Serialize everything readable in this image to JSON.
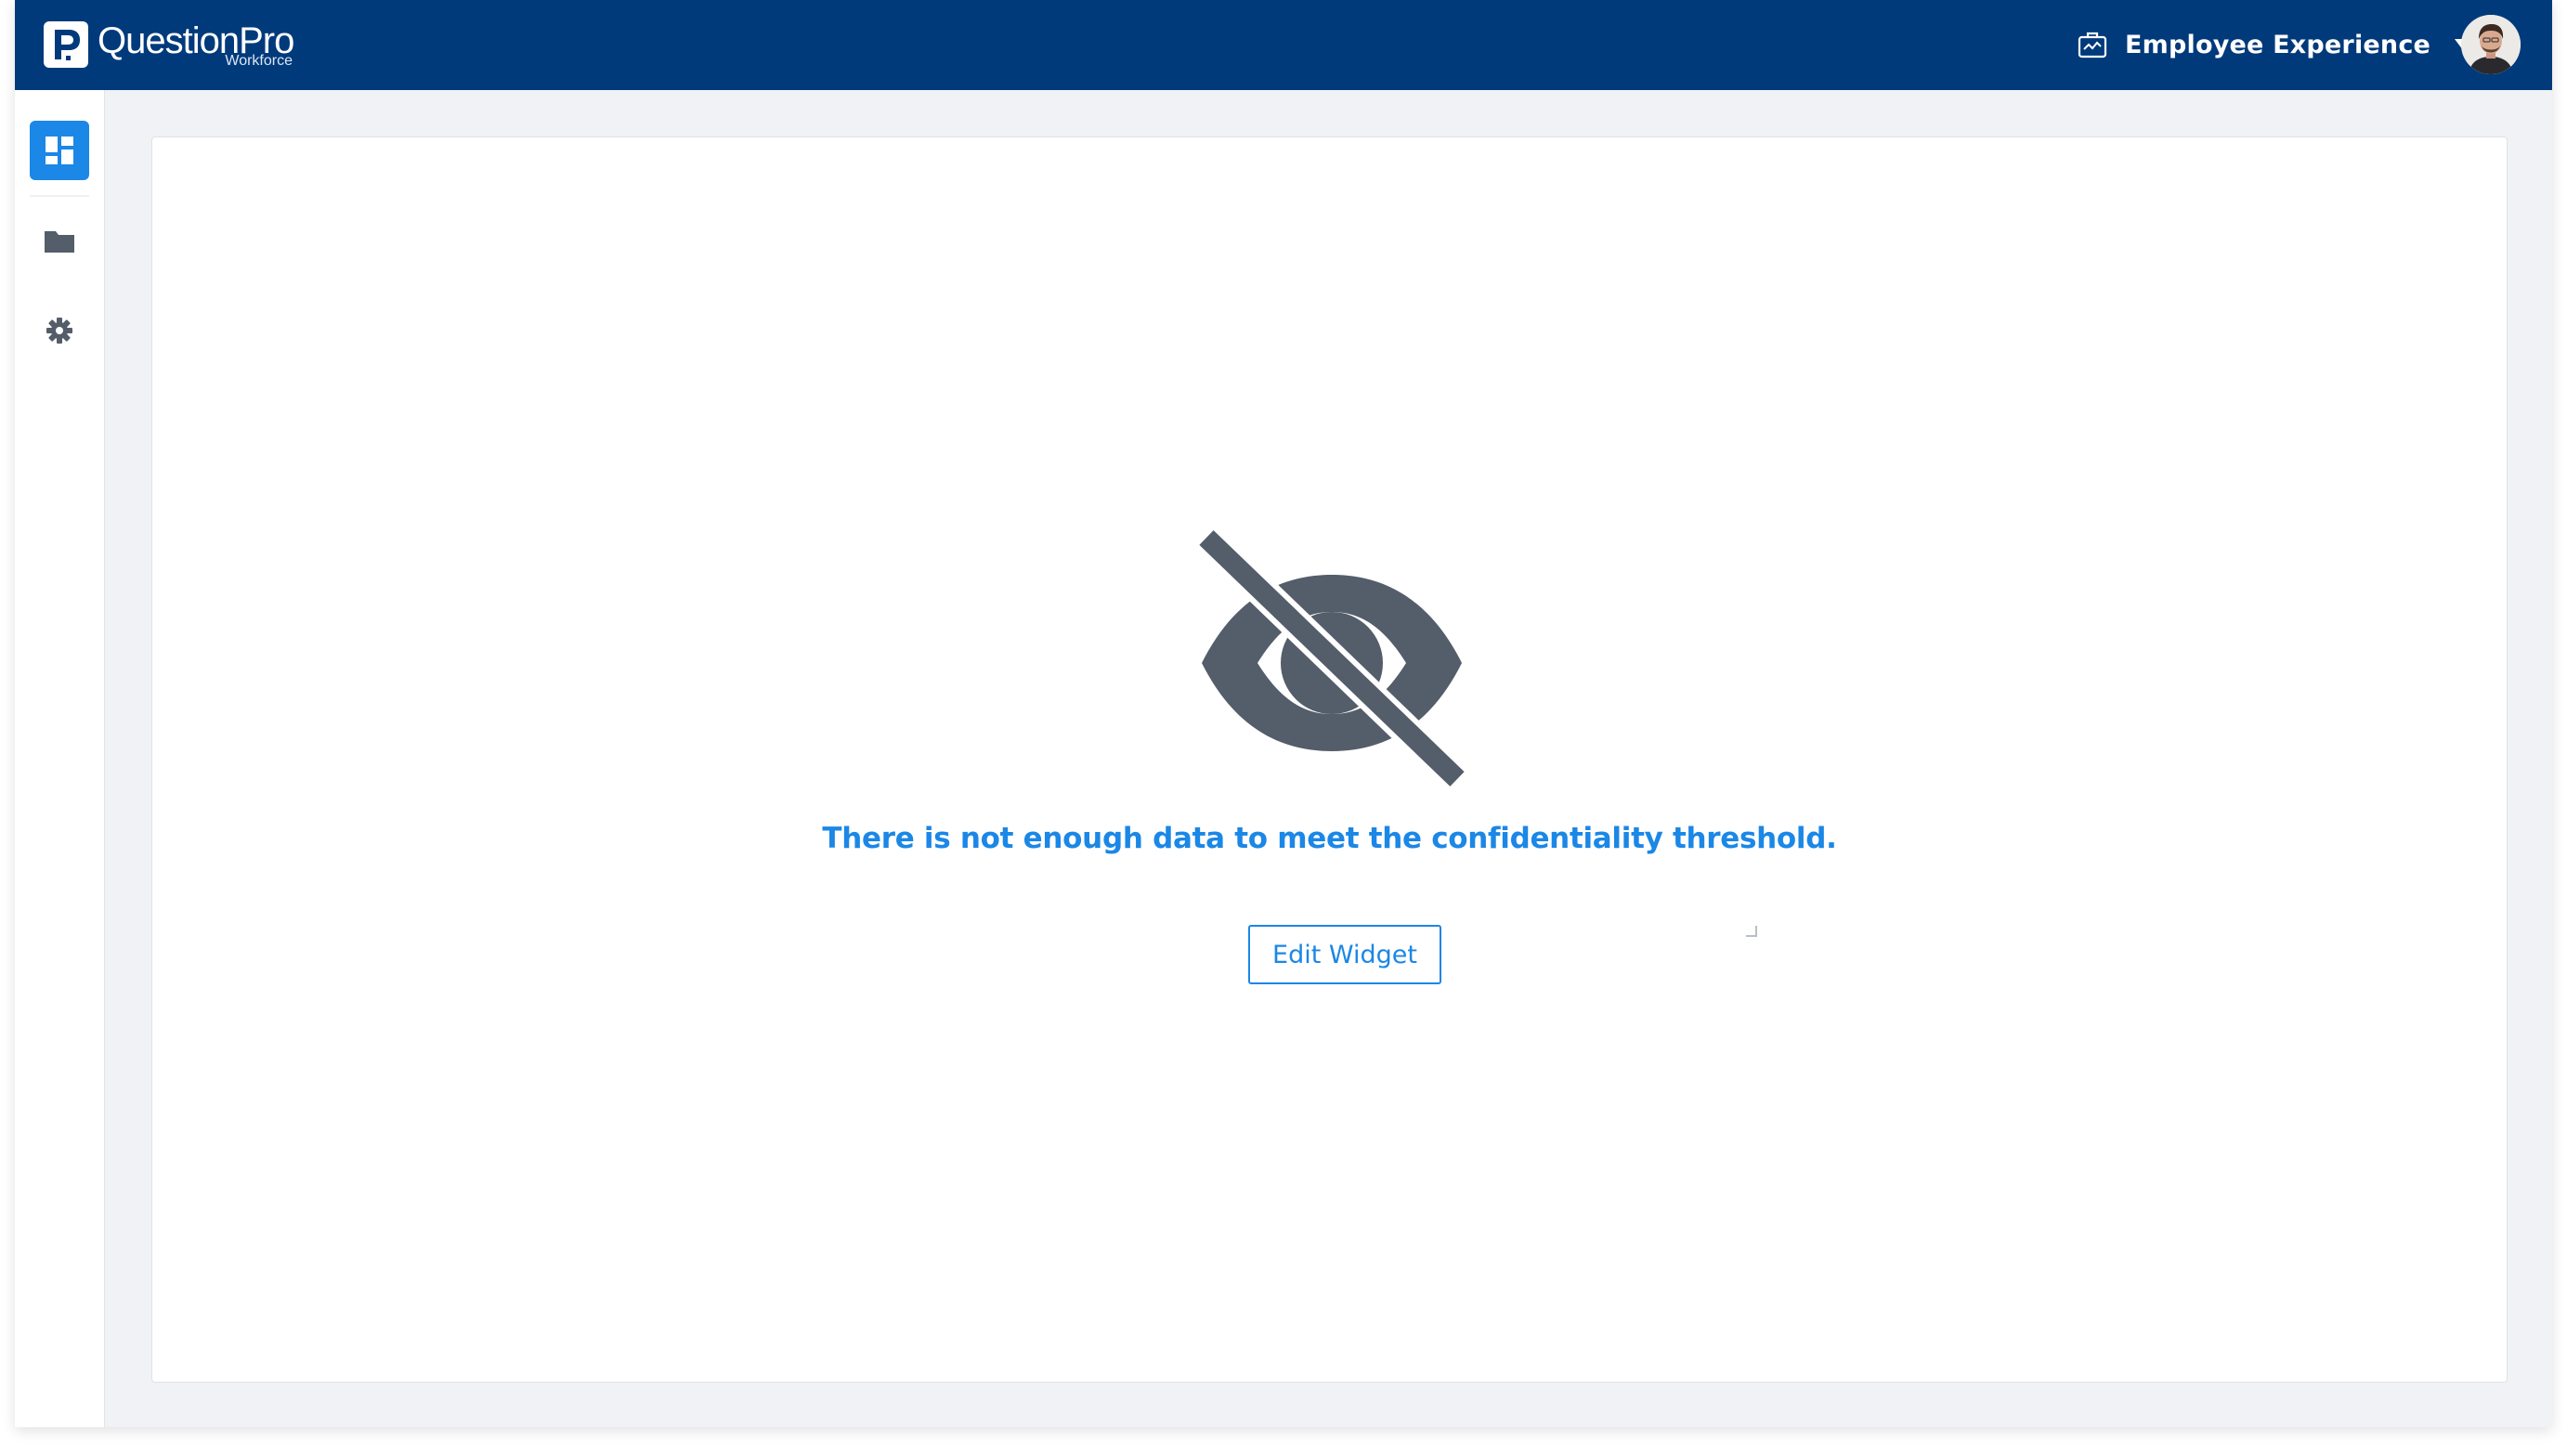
{
  "brand": {
    "name": "QuestionPro",
    "sub": "Workforce"
  },
  "header": {
    "workspace_label": "Employee Experience",
    "workspace_icon": "briefcase-chart-icon",
    "dropdown_icon": "caret-down-icon",
    "avatar_icon": "user-avatar"
  },
  "sidebar": {
    "items": [
      {
        "name": "dashboard",
        "icon": "dashboard-icon",
        "active": true
      },
      {
        "name": "folders",
        "icon": "folder-icon",
        "active": false
      },
      {
        "name": "settings",
        "icon": "gear-icon",
        "active": false
      }
    ]
  },
  "main": {
    "empty_state_icon": "eye-slash-icon",
    "empty_message": "There is not enough data to meet the confidentiality threshold.",
    "edit_button_label": "Edit Widget"
  },
  "colors": {
    "header_bg": "#013a7b",
    "accent": "#1b87e6",
    "icon_gray": "#545d6a",
    "page_bg": "#f1f2f5"
  }
}
